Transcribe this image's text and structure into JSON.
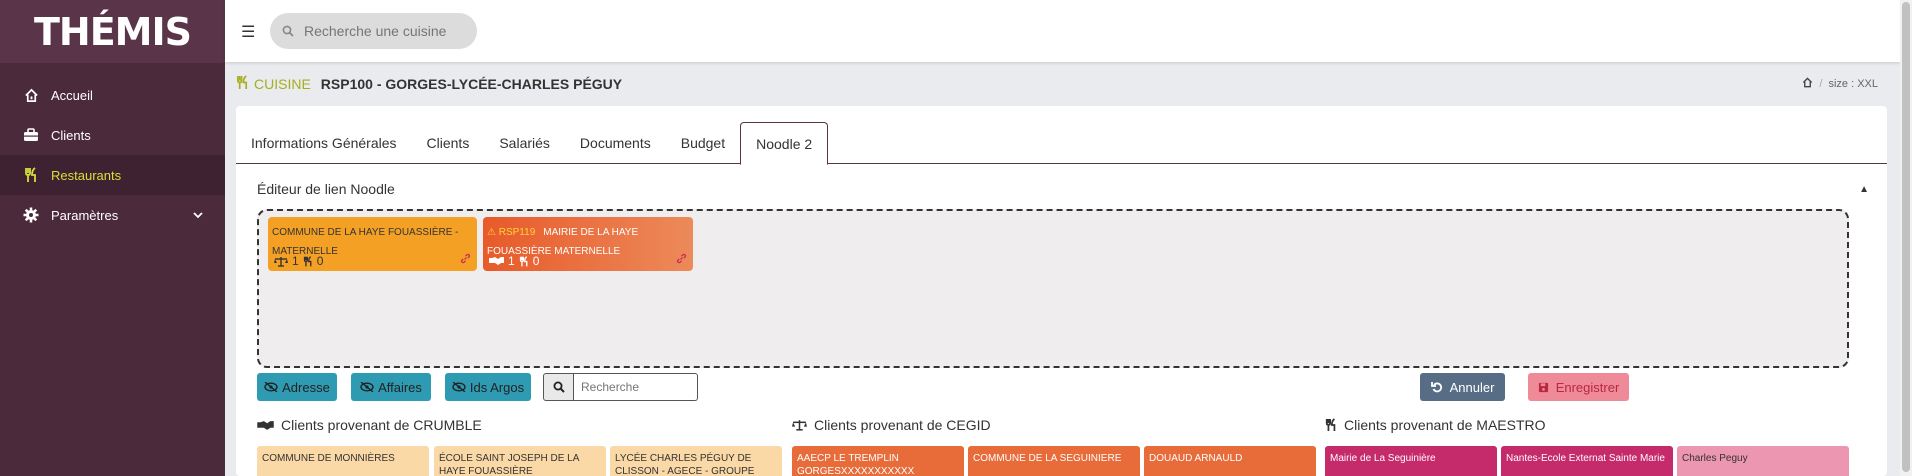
{
  "app": {
    "logo": "THÉMIS",
    "brand_color": "#4b2a3c",
    "accent_color": "#d7df3a"
  },
  "sidebar": {
    "items": [
      {
        "label": "Accueil",
        "icon": "home-icon",
        "active": false
      },
      {
        "label": "Clients",
        "icon": "briefcase-icon",
        "active": false
      },
      {
        "label": "Restaurants",
        "icon": "utensils-icon",
        "active": true
      },
      {
        "label": "Paramètres",
        "icon": "gear-icon",
        "active": false
      }
    ]
  },
  "topbar": {
    "search_placeholder": "Recherche une cuisine"
  },
  "header": {
    "section": "CUISINE",
    "title": "RSP100 - GORGES-LYCÉE-CHARLES PÉGUY",
    "size_info": "size : XXL"
  },
  "tabs": [
    {
      "label": "Informations Générales",
      "active": false
    },
    {
      "label": "Clients",
      "active": false
    },
    {
      "label": "Salariés",
      "active": false
    },
    {
      "label": "Documents",
      "active": false
    },
    {
      "label": "Budget",
      "active": false
    },
    {
      "label": "Noodle 2",
      "active": true
    }
  ],
  "editor": {
    "title": "Éditeur de lien Noodle",
    "cards": [
      {
        "name": "COMMUNE DE LA HAYE FOUASSIÈRE - MATERNELLE",
        "count_a": "1",
        "count_b": "0"
      },
      {
        "code": "RSP119",
        "name": "MAIRIE DE LA HAYE FOUASSIÈRE MATERNELLE",
        "count_a": "1",
        "count_b": "0"
      }
    ]
  },
  "toolbar": {
    "adresse": "Adresse",
    "affaires": "Affaires",
    "ids_argos": "Ids Argos",
    "search_placeholder": "Recherche",
    "annuler": "Annuler",
    "enregistrer": "Enregistrer"
  },
  "columns": {
    "crumble": {
      "title": "Clients provenant de CRUMBLE",
      "items": [
        "COMMUNE DE MONNIÈRES",
        "ÉCOLE SAINT JOSEPH DE LA HAYE FOUASSIÈRE",
        "LYCÉE CHARLES PÉGUY DE CLISSON - AGECE - GROUPE"
      ]
    },
    "cegid": {
      "title": "Clients provenant de CEGID",
      "items": [
        "AAECP LE TREMPLIN GORGESXXXXXXXXXXX",
        "COMMUNE DE LA SEGUINIERE",
        "DOUAUD ARNAULD"
      ]
    },
    "maestro": {
      "title": "Clients provenant de MAESTRO",
      "items": [
        "Mairie de La Seguinière",
        "Nantes-Ecole Externat Sainte Marie",
        "Charles Peguy"
      ]
    }
  }
}
